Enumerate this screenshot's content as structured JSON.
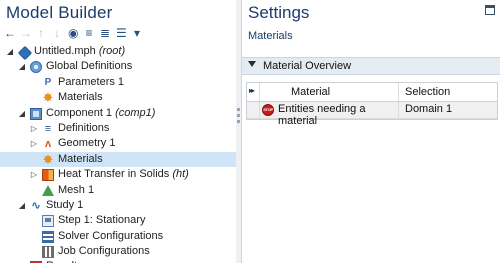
{
  "model_builder": {
    "title": "Model Builder",
    "toolbar": [
      {
        "icon": "arrow-left-icon",
        "glyph": "←",
        "enabled": true
      },
      {
        "icon": "arrow-right-icon",
        "glyph": "→",
        "enabled": false
      },
      {
        "icon": "move-up-icon",
        "glyph": "↑",
        "enabled": false
      },
      {
        "icon": "move-down-icon",
        "glyph": "↓",
        "enabled": false
      },
      {
        "icon": "show-icon",
        "glyph": "◉",
        "enabled": true
      },
      {
        "icon": "collapse-all-icon",
        "glyph": "≡",
        "enabled": true
      },
      {
        "icon": "expand-all-icon",
        "glyph": "≣",
        "enabled": true
      },
      {
        "icon": "list-icon",
        "glyph": "☰",
        "enabled": true
      },
      {
        "icon": "dropdown-icon",
        "glyph": "▾",
        "enabled": true
      }
    ],
    "tree": [
      {
        "level": 0,
        "toggle": "expanded",
        "icon": "model-icon",
        "label": "Untitled.mph",
        "suffix": " (root)"
      },
      {
        "level": 1,
        "toggle": "expanded",
        "icon": "global-definitions-icon",
        "label": "Global Definitions",
        "suffix": ""
      },
      {
        "level": 2,
        "toggle": "none",
        "icon": "parameters-icon",
        "label": "Parameters 1",
        "suffix": ""
      },
      {
        "level": 2,
        "toggle": "none",
        "icon": "materials-icon",
        "label": "Materials",
        "suffix": ""
      },
      {
        "level": 1,
        "toggle": "expanded",
        "icon": "component-icon",
        "label": "Component 1",
        "suffix": " (comp1)"
      },
      {
        "level": 2,
        "toggle": "collapsed",
        "icon": "definitions-icon",
        "label": "Definitions",
        "suffix": ""
      },
      {
        "level": 2,
        "toggle": "collapsed",
        "icon": "geometry-icon",
        "label": "Geometry 1",
        "suffix": ""
      },
      {
        "level": 2,
        "toggle": "none",
        "icon": "materials-icon",
        "label": "Materials",
        "suffix": "",
        "selected": true
      },
      {
        "level": 2,
        "toggle": "collapsed",
        "icon": "heat-transfer-icon",
        "label": "Heat Transfer in Solids",
        "suffix": " (ht)"
      },
      {
        "level": 2,
        "toggle": "none",
        "icon": "mesh-icon",
        "label": "Mesh 1",
        "suffix": ""
      },
      {
        "level": 1,
        "toggle": "expanded",
        "icon": "study-icon",
        "label": "Study 1",
        "suffix": ""
      },
      {
        "level": 2,
        "toggle": "none",
        "icon": "study-step-icon",
        "label": "Step 1: Stationary",
        "suffix": ""
      },
      {
        "level": 2,
        "toggle": "none",
        "icon": "solver-configurations-icon",
        "label": "Solver Configurations",
        "suffix": ""
      },
      {
        "level": 2,
        "toggle": "none",
        "icon": "job-configurations-icon",
        "label": "Job Configurations",
        "suffix": ""
      },
      {
        "level": 1,
        "toggle": "collapsed",
        "icon": "results-icon",
        "label": "Results",
        "suffix": ""
      }
    ]
  },
  "settings": {
    "title": "Settings",
    "subtitle": "Materials",
    "section": {
      "label": "Material Overview",
      "table": {
        "header_marker": "▸▸",
        "columns": [
          "Material",
          "Selection"
        ],
        "rows": [
          {
            "status_icon": "stop-icon",
            "status_text": "STOP",
            "material": "Entities needing a material",
            "selection": "Domain 1"
          }
        ]
      }
    }
  }
}
